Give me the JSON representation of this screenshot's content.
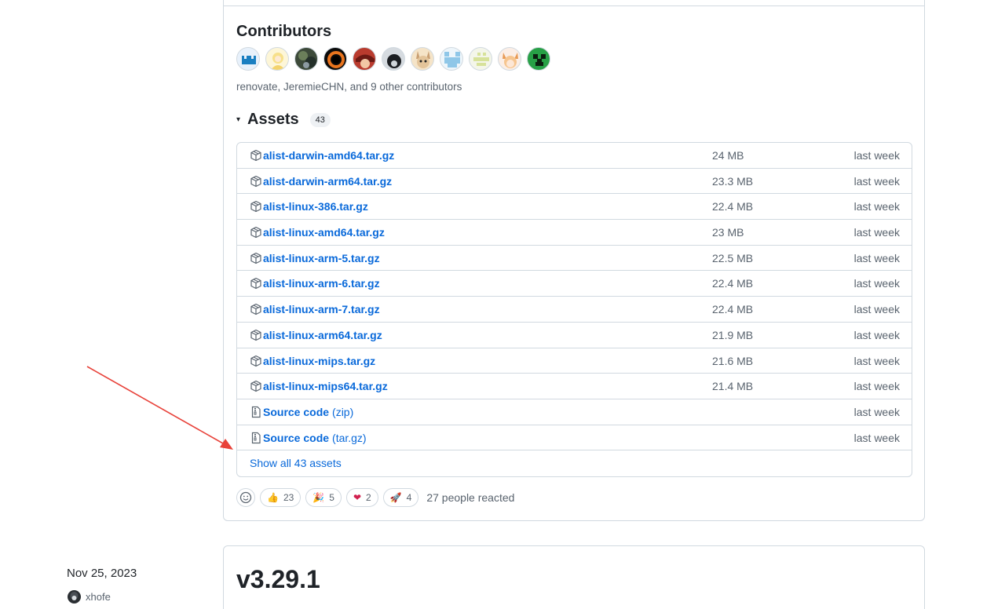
{
  "contributors": {
    "title": "Contributors",
    "summary": "renovate, JeremieCHN, and 9 other contributors",
    "avatars": [
      "avatar-renovate",
      "avatar-jeremiechn",
      "avatar-3",
      "avatar-4",
      "avatar-5",
      "avatar-6",
      "avatar-7",
      "avatar-8",
      "avatar-9",
      "avatar-10",
      "avatar-11"
    ]
  },
  "assets": {
    "caret": "▾",
    "title": "Assets",
    "count": "43",
    "rows": [
      {
        "name": "alist-darwin-amd64.tar.gz",
        "size": "24 MB",
        "date": "last week"
      },
      {
        "name": "alist-darwin-arm64.tar.gz",
        "size": "23.3 MB",
        "date": "last week"
      },
      {
        "name": "alist-linux-386.tar.gz",
        "size": "22.4 MB",
        "date": "last week"
      },
      {
        "name": "alist-linux-amd64.tar.gz",
        "size": "23 MB",
        "date": "last week"
      },
      {
        "name": "alist-linux-arm-5.tar.gz",
        "size": "22.5 MB",
        "date": "last week"
      },
      {
        "name": "alist-linux-arm-6.tar.gz",
        "size": "22.4 MB",
        "date": "last week"
      },
      {
        "name": "alist-linux-arm-7.tar.gz",
        "size": "22.4 MB",
        "date": "last week"
      },
      {
        "name": "alist-linux-arm64.tar.gz",
        "size": "21.9 MB",
        "date": "last week"
      },
      {
        "name": "alist-linux-mips.tar.gz",
        "size": "21.6 MB",
        "date": "last week"
      },
      {
        "name": "alist-linux-mips64.tar.gz",
        "size": "21.4 MB",
        "date": "last week"
      }
    ],
    "source_rows": [
      {
        "name": "Source code",
        "suffix": "(zip)",
        "date": "last week"
      },
      {
        "name": "Source code",
        "suffix": "(tar.gz)",
        "date": "last week"
      }
    ],
    "show_all": "Show all 43 assets"
  },
  "reactions": {
    "items": [
      {
        "emoji": "👍",
        "count": "23"
      },
      {
        "emoji": "🎉",
        "count": "5"
      },
      {
        "emoji": "❤",
        "count": "2"
      },
      {
        "emoji": "🚀",
        "count": "4"
      }
    ],
    "summary": "27 people reacted"
  },
  "next_release": {
    "date": "Nov 25, 2023",
    "author": "xhofe",
    "version": "v3.29.1"
  },
  "colors": {
    "link": "#0969da",
    "muted": "#59636e",
    "border": "#d1d9e0",
    "annotation_arrow": "#e8423a"
  }
}
